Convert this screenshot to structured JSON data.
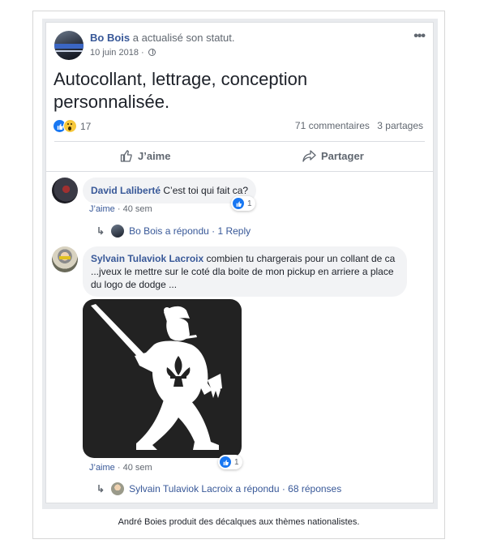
{
  "post": {
    "author": "Bo Bois",
    "action": "a actualisé son statut.",
    "date": "10 juin 2018 ·",
    "menu_icon": "more-dots-icon",
    "privacy_icon": "globe-icon",
    "text": "Autocollant, lettrage, conception personnalisée.",
    "reaction_count": "17",
    "comments_count": "71 commentaires",
    "shares_count": "3 partages",
    "like_label": "J’aime",
    "share_label": "Partager"
  },
  "comments": [
    {
      "author": "David Laliberté",
      "text": "C’est toi qui fait ca?",
      "reactions": "1",
      "like": "J’aime",
      "time": "40 sem",
      "reply_text": "Bo Bois a répondu · 1 Reply"
    },
    {
      "author": "Sylvain Tulaviok Lacroix",
      "text": "combien tu chargerais pour un collant de ca ...jveux le mettre sur le coté dla boite de mon pickup en arriere a place du logo de dodge ...",
      "reactions": "1",
      "like": "J’aime",
      "time": "40 sem",
      "reply_text": "Sylvain Tulaviok Lacroix a répondu · 68 réponses"
    }
  ],
  "caption": "André Boies produit des décalques aux thèmes nationalistes.",
  "colors": {
    "link": "#385898",
    "like_blue": "#1877f2",
    "bubble": "#f2f3f5",
    "page_bg": "#e9ebee"
  }
}
